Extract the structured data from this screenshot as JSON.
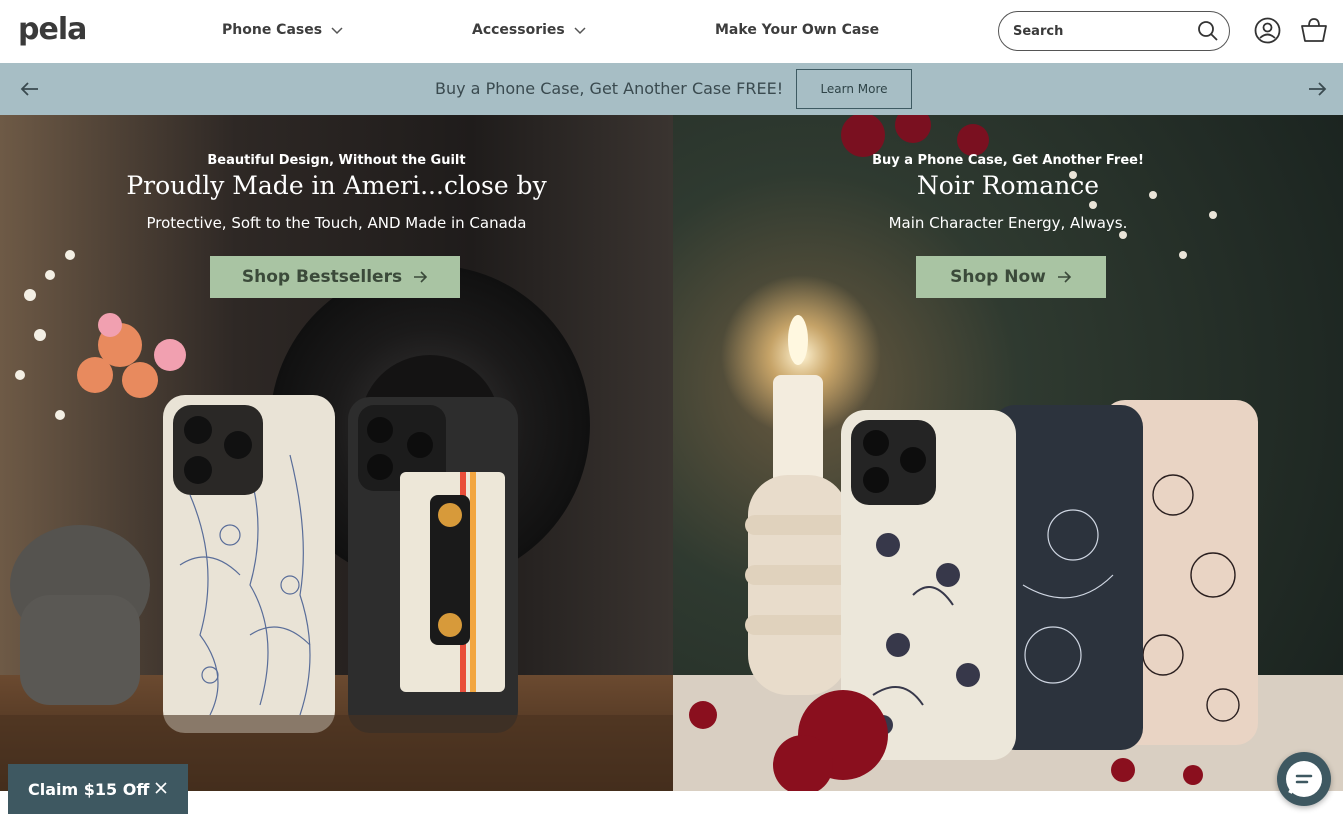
{
  "header": {
    "logo": "pela",
    "nav": [
      {
        "label": "Phone Cases",
        "has_dropdown": true
      },
      {
        "label": "Accessories",
        "has_dropdown": true
      },
      {
        "label": "Make Your Own Case",
        "has_dropdown": false
      }
    ],
    "search_placeholder": "Search",
    "icons": [
      "search-icon",
      "account-icon",
      "cart-icon"
    ]
  },
  "promo": {
    "text": "Buy a Phone Case, Get Another Case FREE!",
    "button": "Learn More",
    "background": "#a7bec5"
  },
  "hero": [
    {
      "eyebrow": "Beautiful Design, Without the Guilt",
      "title": "Proudly Made in Ameri...close by",
      "subtitle": "Protective, Soft to the Touch, AND Made in Canada",
      "button": "Shop Bestsellers"
    },
    {
      "eyebrow": "Buy a Phone Case, Get Another Free!",
      "title": "Noir Romance",
      "subtitle": "Main Character Energy, Always.",
      "button": "Shop Now"
    }
  ],
  "popup": {
    "label": "Claim $15 Off"
  },
  "colors": {
    "accent_green": "#a9c4a3",
    "dark_teal": "#3e5861",
    "promo_blue": "#a7bec5"
  }
}
